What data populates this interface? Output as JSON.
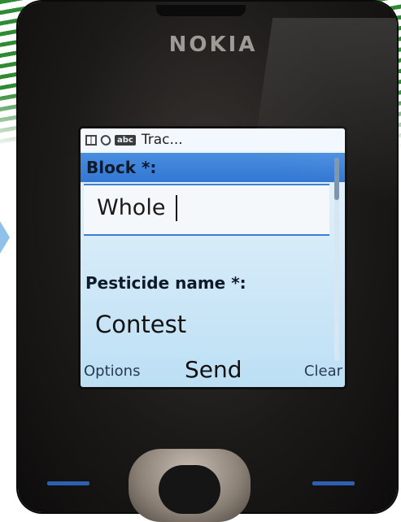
{
  "device": {
    "brand": "NOKIA"
  },
  "screen": {
    "status_bar": {
      "icons": [
        "grid-icon",
        "paperclip-icon"
      ],
      "input_mode": "abc",
      "title": "Trac..."
    },
    "fields": [
      {
        "label": "Block *:",
        "value": "Whole"
      },
      {
        "label": "Pesticide name *:",
        "value": "Contest"
      }
    ],
    "softkeys": {
      "left": "Options",
      "middle": "Send",
      "right": "Clear"
    }
  },
  "colors": {
    "highlight": "#3277d2",
    "screen_bg": "#d3eaf8",
    "keypad_accent": "#2f5fb0"
  }
}
